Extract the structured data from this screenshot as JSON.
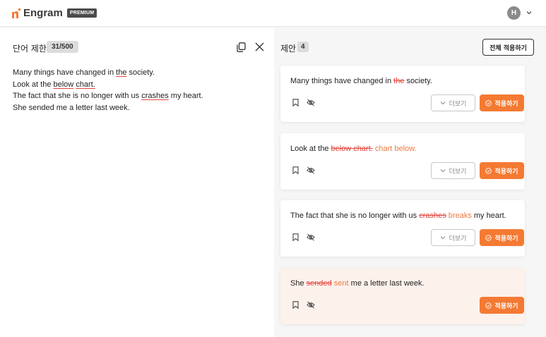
{
  "app": {
    "name": "Engram",
    "badge": "PREMIUM",
    "avatar_initial": "H"
  },
  "left": {
    "title": "단어 제한",
    "word_count": "31/500",
    "lines": [
      {
        "before": "Many things have changed in ",
        "err": "the",
        "after": " society."
      },
      {
        "before": "Look at the ",
        "err": "below",
        "mid": " ",
        "err2": "chart.",
        "after": ""
      },
      {
        "before": "The fact that she is no longer with us ",
        "err": "crashes",
        "after": " my heart."
      },
      {
        "before": "She sended me a letter last week.",
        "err": "",
        "after": ""
      }
    ]
  },
  "right": {
    "title": "제안",
    "count": "4",
    "apply_all_label": "전체 적용하기",
    "more_label": "더보기",
    "apply_label": "적용하기",
    "suggestions": [
      {
        "before": "Many things have changed in ",
        "del": "the",
        "ins": "",
        "after": " society."
      },
      {
        "before": "Look at the ",
        "del": "below chart.",
        "ins": " chart below.",
        "after": ""
      },
      {
        "before": "The fact that she is no longer with us ",
        "del": "crashes",
        "ins": " breaks",
        "after": " my heart."
      },
      {
        "before": "She ",
        "del": "sended",
        "ins": " sent",
        "after": " me a letter last week."
      }
    ]
  },
  "colors": {
    "accent": "#f47a33",
    "error": "#e2453c"
  }
}
